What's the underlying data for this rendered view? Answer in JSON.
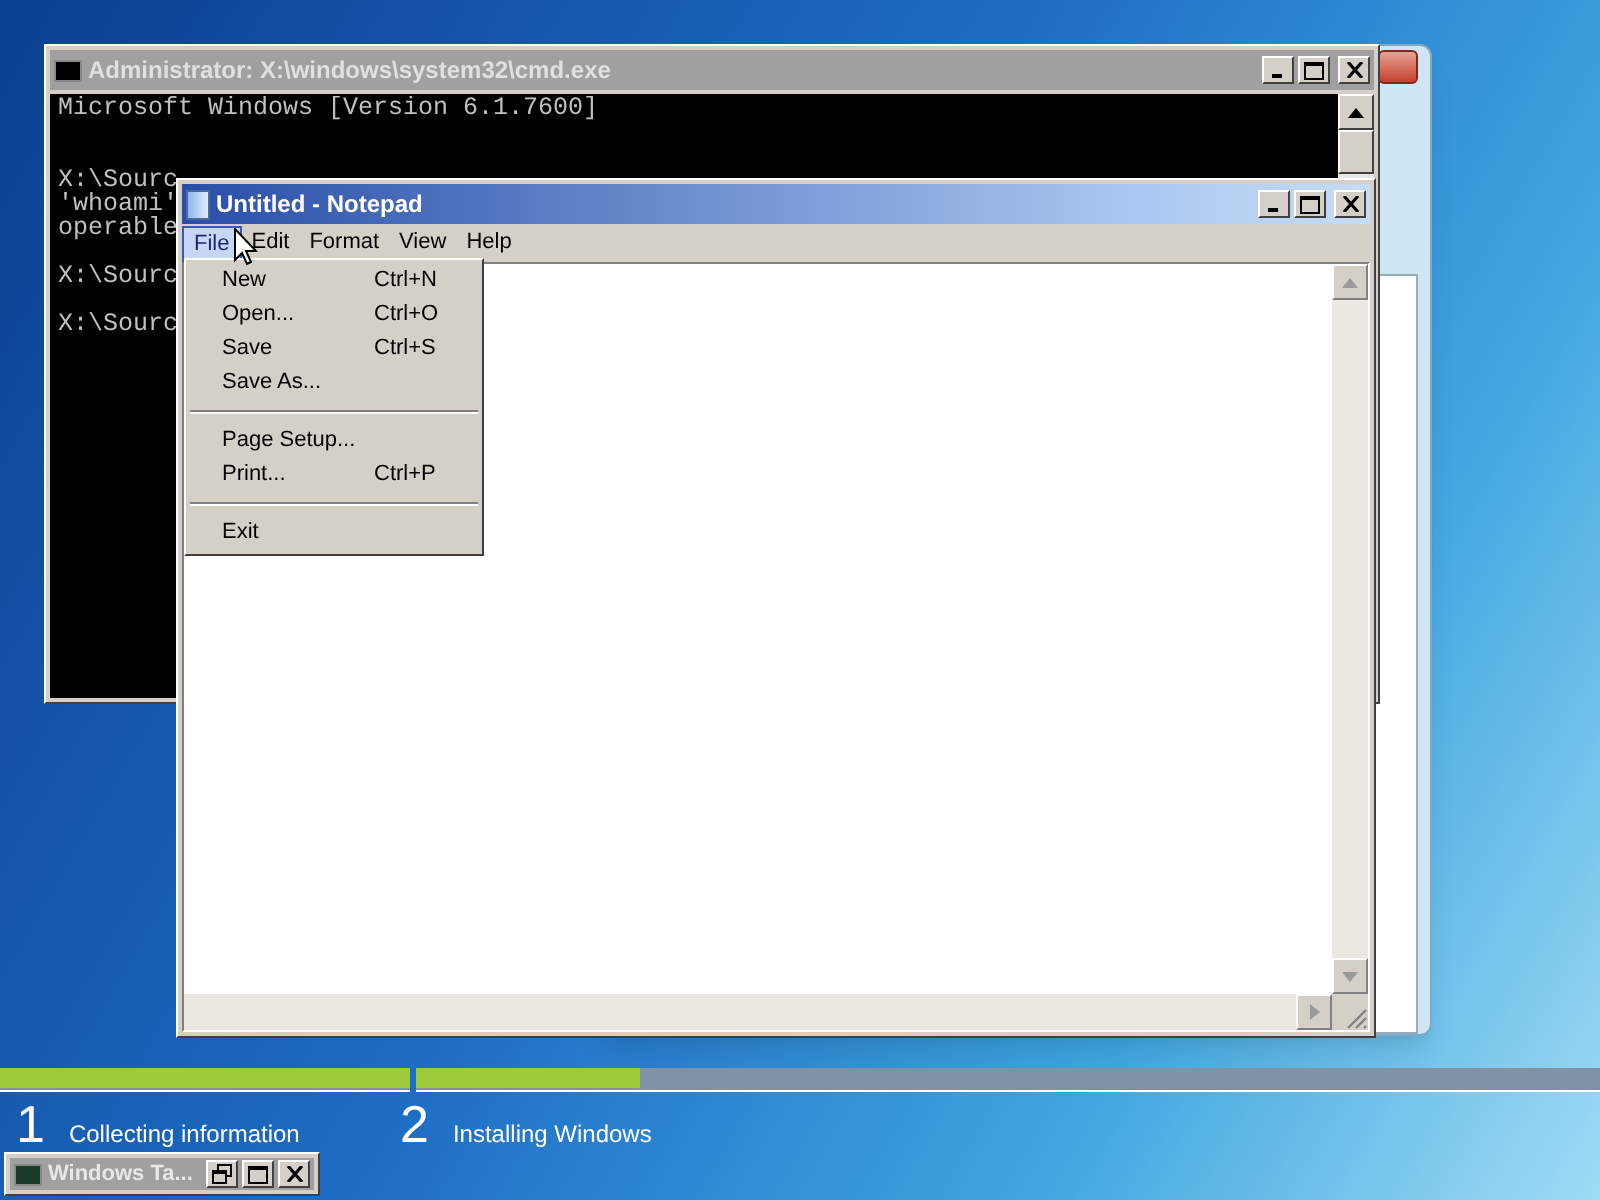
{
  "setup_window": {
    "step_list": [
      {
        "number": "1",
        "label": "Collecting information",
        "level": 1
      },
      {
        "number": "2",
        "label": "Installing Windows",
        "level": 0.19
      }
    ]
  },
  "cmd_window": {
    "title": "Administrator: X:\\windows\\system32\\cmd.exe",
    "active": false,
    "banner": "Microsoft Windows [Version 6.1.7600]",
    "blocks": [
      [
        "X:\\Sourc",
        "'whoami'",
        "operable"
      ],
      [
        "X:\\Sourc"
      ],
      [
        "X:\\Sourc"
      ]
    ]
  },
  "notepad": {
    "title": "Untitled - Notepad",
    "active": true,
    "menu": [
      {
        "label": "File",
        "selected": true
      },
      {
        "label": "Edit",
        "selected": false
      },
      {
        "label": "Format",
        "selected": false
      },
      {
        "label": "View",
        "selected": false
      },
      {
        "label": "Help",
        "selected": false
      }
    ],
    "file_menu": [
      {
        "kind": "item",
        "label": "New",
        "shortcut": "Ctrl+N"
      },
      {
        "kind": "item",
        "label": "Open...",
        "shortcut": "Ctrl+O"
      },
      {
        "kind": "item",
        "label": "Save",
        "shortcut": "Ctrl+S"
      },
      {
        "kind": "item",
        "label": "Save As..."
      },
      {
        "kind": "separator"
      },
      {
        "kind": "item",
        "label": "Page Setup..."
      },
      {
        "kind": "item",
        "label": "Print...",
        "shortcut": "Ctrl+P"
      },
      {
        "kind": "separator"
      },
      {
        "kind": "item",
        "label": "Exit"
      }
    ]
  },
  "minimized_window": {
    "title": "Windows Ta..."
  }
}
